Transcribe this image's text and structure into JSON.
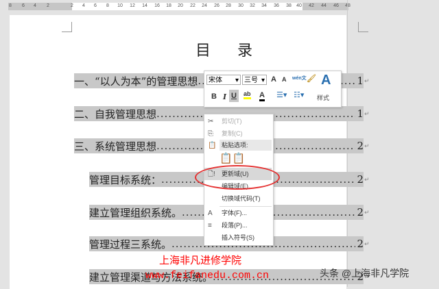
{
  "ruler": {
    "ticks": [
      "8",
      "6",
      "4",
      "2",
      "2",
      "4",
      "6",
      "8",
      "10",
      "12",
      "14",
      "16",
      "18",
      "20",
      "22",
      "24",
      "26",
      "28",
      "30",
      "32",
      "34",
      "36",
      "38",
      "40",
      "42",
      "44",
      "46",
      "48"
    ]
  },
  "document": {
    "title": "目 录",
    "entries": [
      {
        "text": "一、“以人为本”的管理思想",
        "page": "1",
        "level": 1
      },
      {
        "text": "二、自我管理思想",
        "page": "1",
        "level": 1
      },
      {
        "text": "三、系统管理思想",
        "page": "2",
        "level": 1
      },
      {
        "text": "管理目标系统：",
        "page": "2",
        "level": 2
      },
      {
        "text": "建立管理组织系统。",
        "page": "2",
        "level": 2
      },
      {
        "text": "管理过程三系统。",
        "page": "2",
        "level": 2
      },
      {
        "text": "建立管理渠道与方法系统。",
        "page": "2",
        "level": 2
      }
    ]
  },
  "mini_toolbar": {
    "font": "宋体",
    "size": "三号",
    "grow": "A",
    "shrink": "A",
    "phonetic": "wén文",
    "bold": "B",
    "italic": "I",
    "underline": "U",
    "highlight": "ab",
    "font_color": "A",
    "styles_label": "样式",
    "styles_icon": "A"
  },
  "context_menu": {
    "items": [
      {
        "label": "剪切(T)",
        "disabled": true,
        "icon": "✂"
      },
      {
        "label": "复制(C)",
        "disabled": true,
        "icon": "⎘"
      },
      {
        "label": "粘贴选项:",
        "icon": "📋"
      },
      {
        "label": "更新域(U)",
        "icon": "🗋!"
      },
      {
        "label": "编辑域(E)..."
      },
      {
        "label": "切换域代码(T)"
      },
      {
        "label": "字体(F)...",
        "icon": "A"
      },
      {
        "label": "段落(P)...",
        "icon": "≡"
      },
      {
        "label": "插入符号(S)"
      }
    ]
  },
  "watermark": {
    "school": "上海非凡进修学院",
    "url": "www.feifanedu.com.cn",
    "credit": "头条 @上海非凡学院"
  }
}
